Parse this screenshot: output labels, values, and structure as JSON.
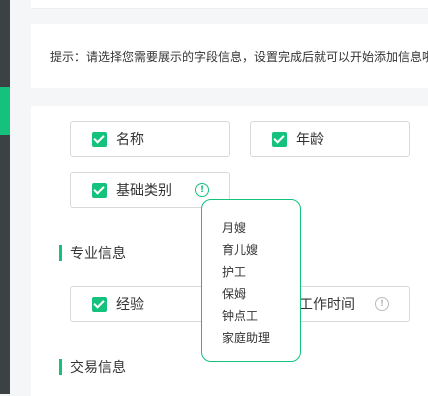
{
  "tip": "提示：请选择您需要展示的字段信息，设置完成后就可以开始添加信息啦",
  "fields": {
    "name": {
      "label": "名称",
      "checked": true
    },
    "age": {
      "label": "年龄",
      "checked": true
    },
    "basic_category": {
      "label": "基础类别",
      "checked": true
    },
    "experience": {
      "label": "经验",
      "checked": true
    },
    "work_time": {
      "label": "工作时间"
    }
  },
  "sections": {
    "professional": "专业信息",
    "trade": "交易信息"
  },
  "category_popover": {
    "items": [
      "月嫂",
      "育儿嫂",
      "护工",
      "保姆",
      "钟点工",
      "家庭助理"
    ]
  },
  "icons": {
    "check": "checkmark-icon",
    "info": "info-circle-icon"
  },
  "colors": {
    "accent": "#15c27d",
    "sidebar": "#3c4143"
  }
}
